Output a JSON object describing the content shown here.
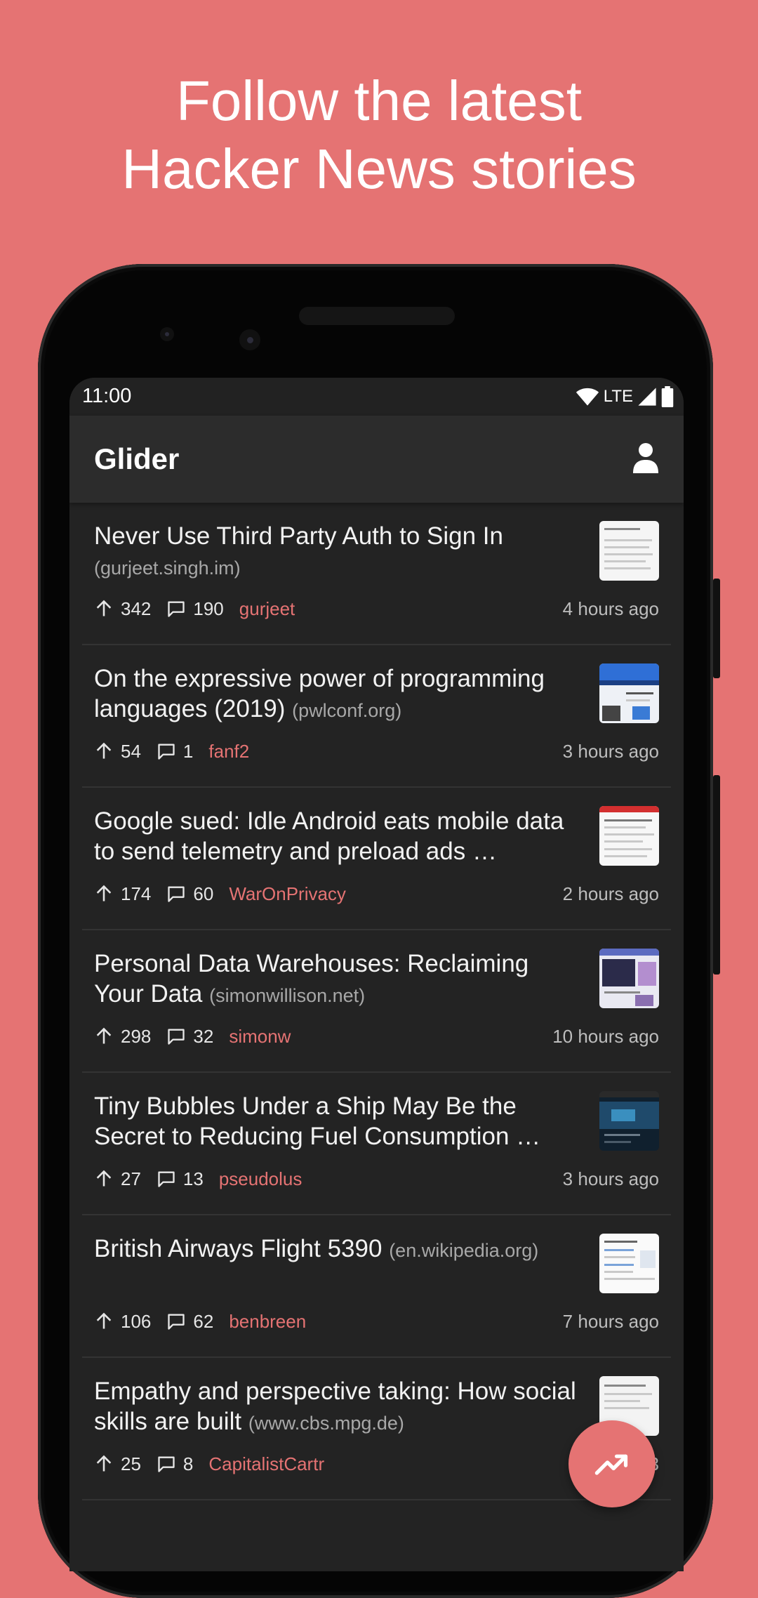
{
  "promo": {
    "line1": "Follow the latest",
    "line2": "Hacker News stories"
  },
  "status_bar": {
    "time": "11:00",
    "network": "LTE",
    "icons": [
      "wifi-icon",
      "signal-icon",
      "battery-icon"
    ]
  },
  "app_bar": {
    "title": "Glider",
    "account_icon": "account-icon"
  },
  "stories": [
    {
      "title": "Never Use Third Party Auth to Sign In",
      "domain": "(gurjeet.singh.im)",
      "points": "342",
      "comments": "190",
      "author": "gurjeet",
      "time": "4 hours ago"
    },
    {
      "title": "On the expressive power of programming languages (2019)",
      "domain": "(pwlconf.org)",
      "points": "54",
      "comments": "1",
      "author": "fanf2",
      "time": "3 hours ago"
    },
    {
      "title": "Google sued: Idle Android eats mobile data to send telemetry and preload ads …",
      "domain": "",
      "points": "174",
      "comments": "60",
      "author": "WarOnPrivacy",
      "time": "2 hours ago"
    },
    {
      "title": "Personal Data Warehouses: Reclaiming Your Data",
      "domain": "(simonwillison.net)",
      "points": "298",
      "comments": "32",
      "author": "simonw",
      "time": "10 hours ago"
    },
    {
      "title": "Tiny Bubbles Under a Ship May Be the Secret to Reducing Fuel Consumption …",
      "domain": "",
      "points": "27",
      "comments": "13",
      "author": "pseudolus",
      "time": "3 hours ago"
    },
    {
      "title": "British Airways Flight 5390",
      "domain": "(en.wikipedia.org)",
      "points": "106",
      "comments": "62",
      "author": "benbreen",
      "time": "7 hours ago"
    },
    {
      "title": "Empathy and perspective taking: How social skills are built",
      "domain": "(www.cbs.mpg.de)",
      "points": "25",
      "comments": "8",
      "author": "CapitalistCartr",
      "time": "3"
    }
  ],
  "fab": {
    "icon": "trending-up-icon"
  },
  "colors": {
    "background": "#e57373",
    "accent": "#e57373",
    "surface": "#232323",
    "app_bar": "#2c2c2c"
  }
}
